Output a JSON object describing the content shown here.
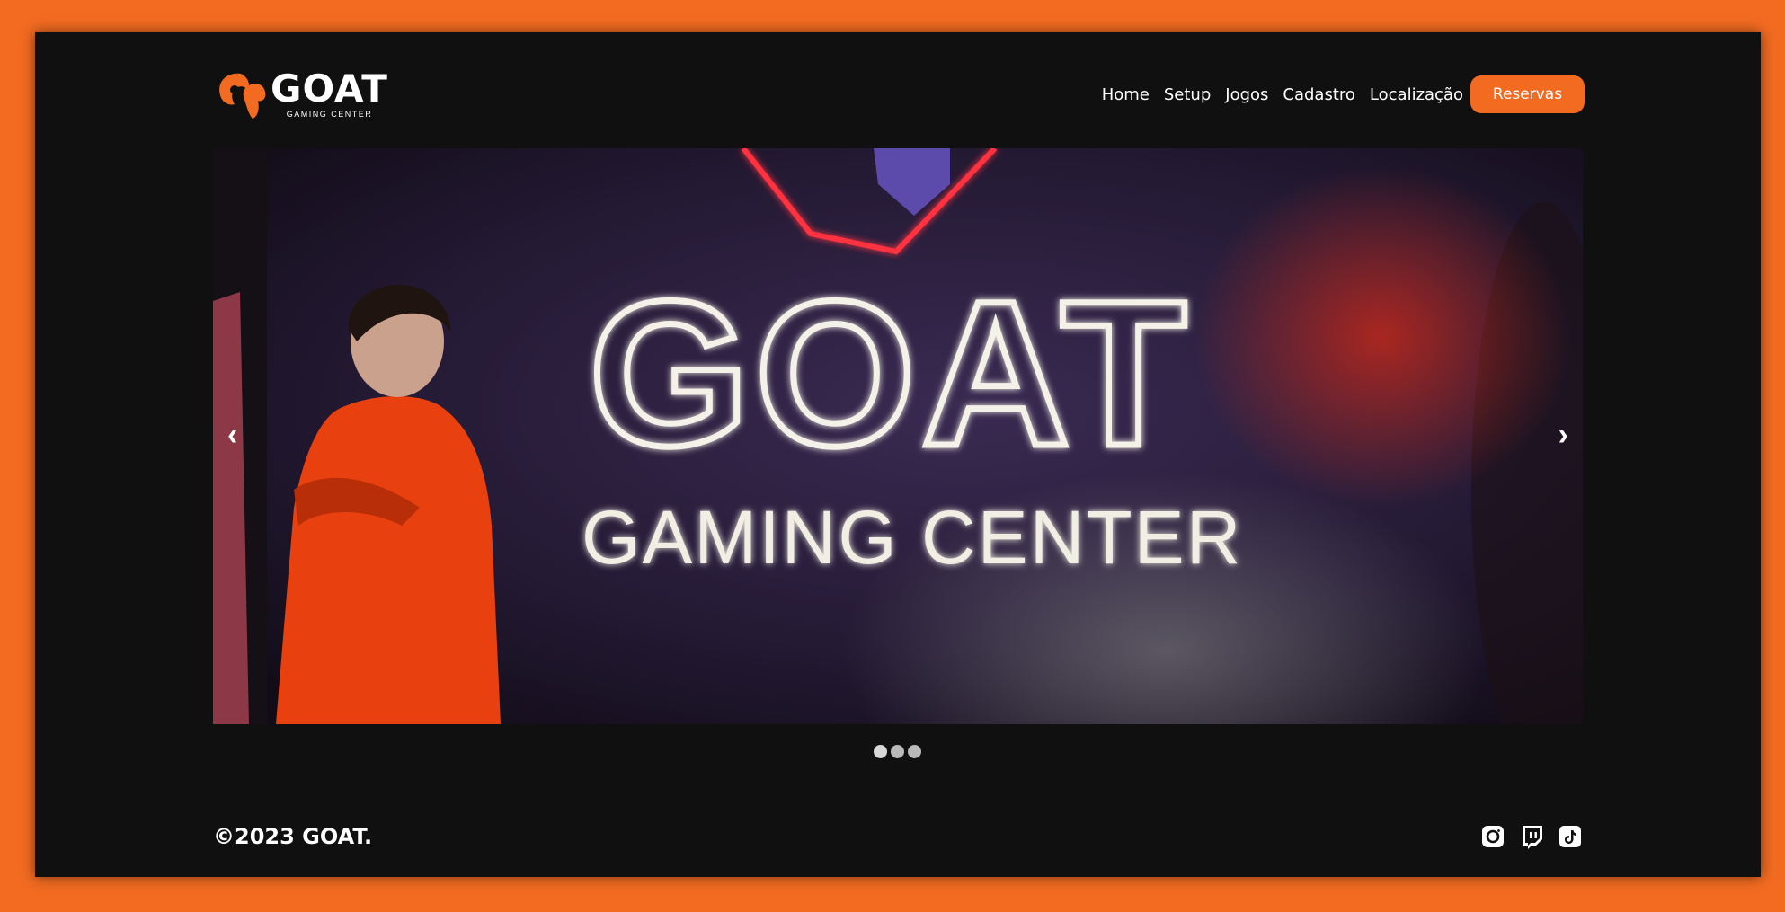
{
  "brand": {
    "name": "GOAT",
    "tagline": "GAMING CENTER",
    "accent_color": "#f26b21",
    "background_color": "#101010"
  },
  "nav": {
    "items": [
      {
        "label": "Home"
      },
      {
        "label": "Setup"
      },
      {
        "label": "Jogos"
      },
      {
        "label": "Cadastro"
      },
      {
        "label": "Localização"
      }
    ],
    "cta_label": "Reservas"
  },
  "carousel": {
    "prev_glyph": "‹",
    "next_glyph": "›",
    "slide_count": 3,
    "active_index": 0,
    "slide": {
      "sign_title": "GOAT",
      "sign_subtitle": "GAMING CENTER"
    }
  },
  "footer": {
    "copyright": "©2023 GOAT.",
    "social_icons": [
      "instagram-icon",
      "twitch-icon",
      "tiktok-icon"
    ]
  }
}
